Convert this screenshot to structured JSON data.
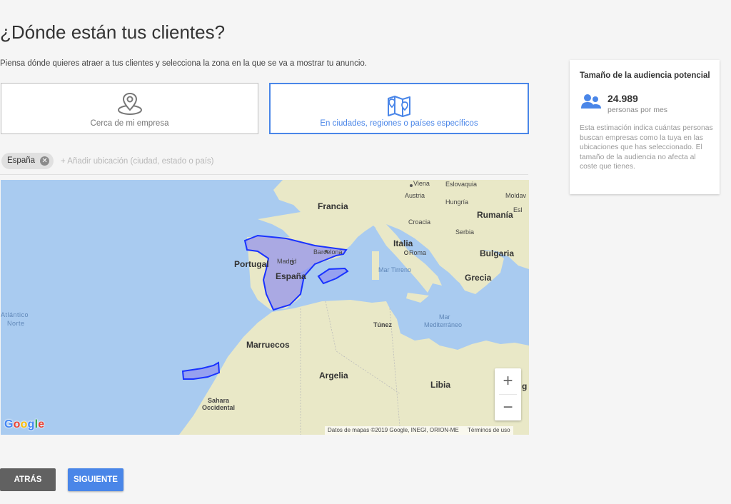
{
  "page": {
    "title": "¿Dónde están tus clientes?",
    "subtitle": "Piensa dónde quieres atraer a tus clientes y selecciona la zona en la que se va a mostrar tu anuncio."
  },
  "options": {
    "nearby": {
      "label": "Cerca de mi empresa",
      "icon": "location-pin-icon"
    },
    "cities": {
      "label": "En ciudades, regiones o países específicos",
      "icon": "map-pins-icon",
      "selected": true
    }
  },
  "location": {
    "chip": "España",
    "placeholder": "+ Añadir ubicación (ciudad, estado o país)"
  },
  "map": {
    "countries": [
      "Francia",
      "Portugal",
      "España",
      "Italia",
      "Grecia",
      "Bulgaria",
      "Rumanía",
      "Hungría",
      "Austria",
      "Croacia",
      "Serbia",
      "Moldav",
      "Esl",
      "Marruecos",
      "Argelia",
      "Libia",
      "Sahara Occidental",
      "Túnez"
    ],
    "sahara_line1": "Sahara",
    "sahara_line2": "Occidental",
    "cities": [
      "Viena",
      "Eslovaquia",
      "Barcelona",
      "Madrid",
      "Roma"
    ],
    "seas": {
      "atlantico_1": "Atlántico",
      "atlantico_2": "Norte",
      "tirreno": "Mar Tirreno",
      "med_1": "Mar",
      "med_2": "Mediterráneo"
    },
    "edge_fragment": "g",
    "zoom_in": "+",
    "zoom_out": "−",
    "attribution": "Datos de mapas ©2019 Google, INEGI, ORION-ME",
    "terms": "Términos de uso",
    "logo": "Google",
    "colors": {
      "water": "#a9cbf0",
      "land": "#e9e8c7",
      "highlight": "#8f8ff0",
      "border": "#1a33ff"
    }
  },
  "audience": {
    "title": "Tamaño de la audiencia potencial",
    "count": "24.989",
    "per": "personas por mes",
    "note": "Esta estimación indica cuántas personas buscan empresas como la tuya en las ubicaciones que has seleccionado. El tamaño de la audiencia no afecta al coste que tienes.",
    "icon": "people-icon"
  },
  "buttons": {
    "back": "ATRÁS",
    "next": "SIGUIENTE"
  }
}
